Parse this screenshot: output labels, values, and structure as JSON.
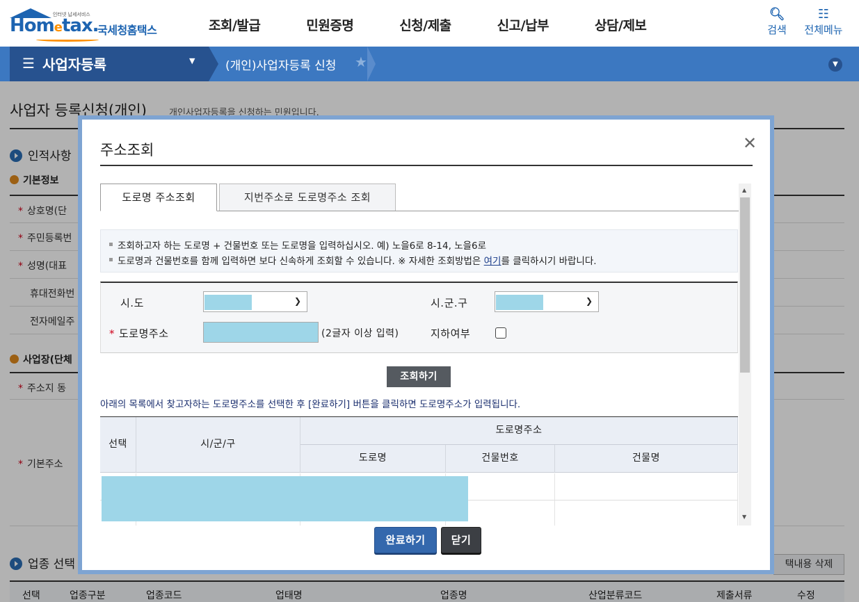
{
  "header": {
    "logo_tagline": "인터넷 납세서비스",
    "logo_brand_left": "Hom",
    "logo_brand_e": "e",
    "logo_brand_right": "tax.",
    "logo_kor": "국세청홈택스",
    "menu": [
      "조회/발급",
      "민원증명",
      "신청/제출",
      "신고/납부",
      "상담/제보"
    ],
    "search_label": "검색",
    "allmenu_label": "전체메뉴"
  },
  "navbar": {
    "current": "사업자등록",
    "breadcrumb": "(개인)사업자등록 신청"
  },
  "page": {
    "title": "사업자 등록신청(개인)",
    "description": "개인사업자등록을 신청하는 민원입니다.",
    "section_personal": "인적사항",
    "sub_basic": "기본정보",
    "rows": [
      "상호명(단",
      "주민등록번",
      "성명(대표",
      "휴대전화번",
      "전자메일주"
    ],
    "sub_business": "사업장(단체",
    "row_address_same": "주소지 동",
    "row_base_address": "기본주소",
    "section_industry": "업종 선택",
    "delete_button": "택내용 삭제",
    "table_headers": [
      "선택",
      "업종구분",
      "업종코드",
      "업태명",
      "업종명",
      "산업분류코드",
      "제출서류",
      "수정"
    ]
  },
  "modal": {
    "title": "주소조회",
    "tabs": [
      "도로명 주소조회",
      "지번주소로 도로명주소 조회"
    ],
    "info_lines": [
      "조회하고자 하는 도로명 + 건물번호 또는 도로명을 입력하십시오. 예) 노을6로 8-14, 노을6로",
      "도로명과 건물번호를 함께 입력하면 보다 신속하게 조회할 수 있습니다. ※ 자세한 조회방법은 "
    ],
    "info_link": "여기",
    "info_tail": "를 클릭하시기 바랍니다.",
    "label_sido": "시.도",
    "label_sigungu": "시.군.구",
    "label_road": "도로명주소",
    "road_hint": "(2글자 이상 입력)",
    "label_underground": "지하여부",
    "search_button": "조회하기",
    "note": "아래의 목록에서 찾고자하는 도로명주소를 선택한 후 [완료하기] 버튼을 클릭하면 도로명주소가 입력됩니다.",
    "table": {
      "col_select": "선택",
      "col_sigungu": "시/군/구",
      "col_group": "도로명주소",
      "col_road": "도로명",
      "col_bldg_no": "건물번호",
      "col_bldg_name": "건물명"
    },
    "ok_button": "완료하기",
    "close_button": "닫기"
  },
  "colors": {
    "brand_blue": "#1d64b1",
    "nav_blue": "#3c78c1",
    "nav_dark": "#27528f",
    "redacted": "#9ed6e8",
    "required": "#d0021b"
  }
}
